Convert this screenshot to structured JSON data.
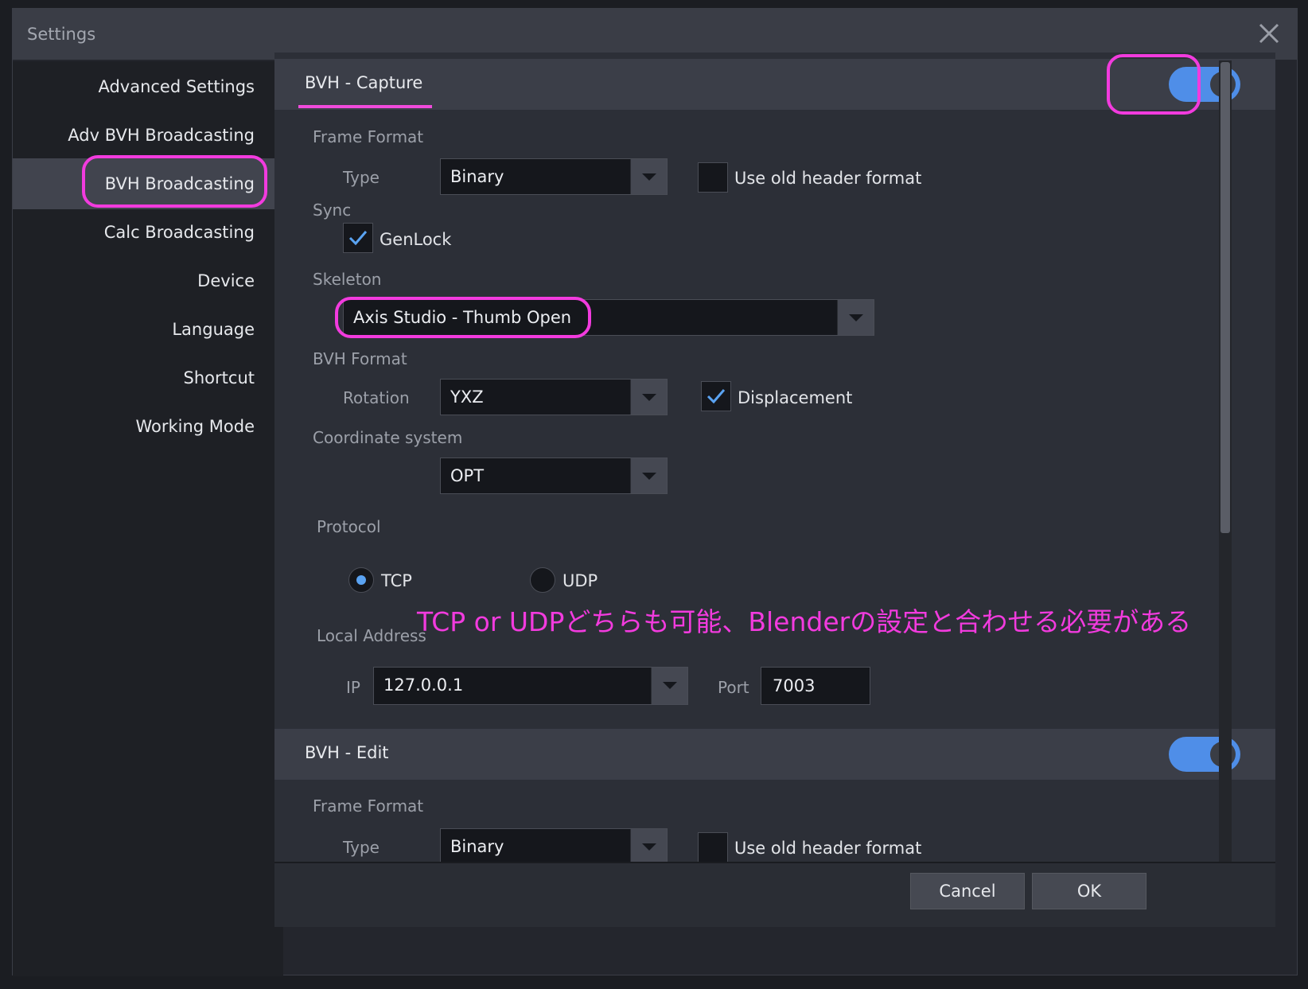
{
  "window": {
    "title": "Settings",
    "close_icon": "close-icon"
  },
  "sidebar": {
    "items": [
      {
        "label": "Advanced Settings"
      },
      {
        "label": "Adv BVH Broadcasting"
      },
      {
        "label": "BVH Broadcasting",
        "active": true
      },
      {
        "label": "Calc Broadcasting"
      },
      {
        "label": "Device"
      },
      {
        "label": "Language"
      },
      {
        "label": "Shortcut"
      },
      {
        "label": "Working Mode"
      }
    ]
  },
  "capture": {
    "title": "BVH - Capture",
    "enabled": true,
    "frame_format_label": "Frame Format",
    "type_label": "Type",
    "type_value": "Binary",
    "old_header_label": "Use old header format",
    "old_header_checked": false,
    "sync_label": "Sync",
    "genlock_label": "GenLock",
    "genlock_checked": true,
    "skeleton_label": "Skeleton",
    "skeleton_value": "Axis Studio - Thumb Open",
    "bvh_format_label": "BVH Format",
    "rotation_label": "Rotation",
    "rotation_value": "YXZ",
    "displacement_label": "Displacement",
    "displacement_checked": true,
    "coord_label": "Coordinate system",
    "coord_value": "OPT",
    "protocol_label": "Protocol",
    "tcp_label": "TCP",
    "udp_label": "UDP",
    "protocol_selected": "TCP",
    "local_address_label": "Local Address",
    "ip_label": "IP",
    "ip_value": "127.0.0.1",
    "port_label": "Port",
    "port_value": "7003"
  },
  "edit": {
    "title": "BVH - Edit",
    "enabled": true,
    "frame_format_label": "Frame Format",
    "type_label": "Type",
    "type_value": "Binary",
    "old_header_label": "Use old header format"
  },
  "annotation": {
    "note": "TCP or UDPどちらも可能、Blenderの設定と合わせる必要がある",
    "color": "#f23bde"
  },
  "footer": {
    "cancel_label": "Cancel",
    "ok_label": "OK"
  },
  "colors": {
    "accent": "#4f8ee8",
    "annotation": "#f23bde",
    "background": "#2c2f37"
  }
}
